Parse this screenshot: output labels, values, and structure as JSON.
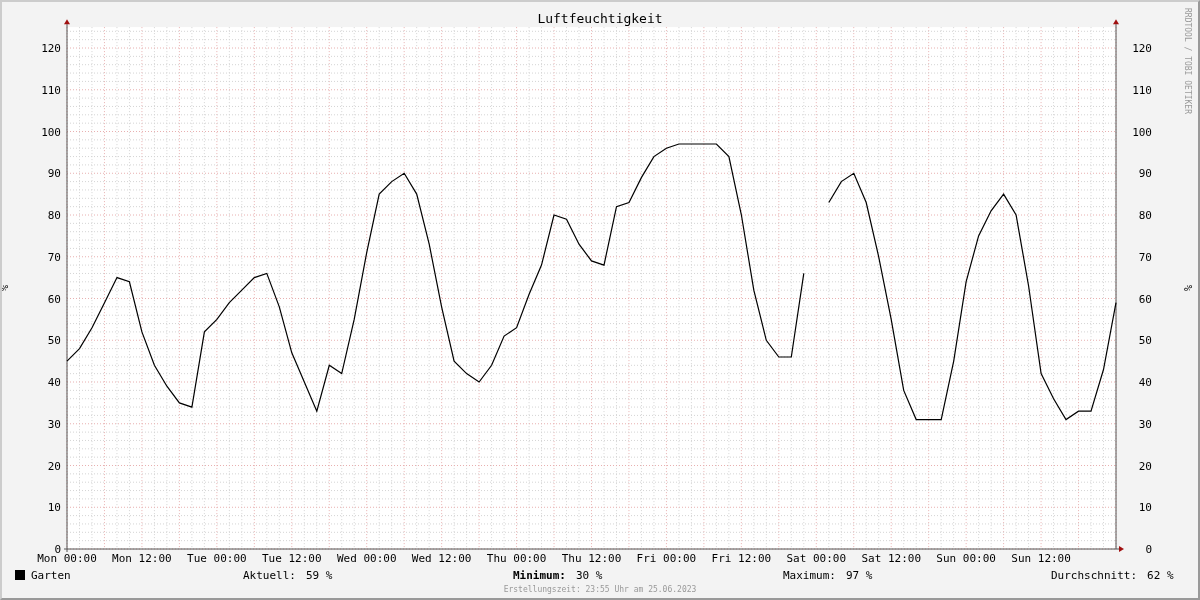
{
  "title": "Luftfeuchtigkeit",
  "credit": "RRDTOOL / TOBI OETIKER",
  "chart_data": {
    "type": "line",
    "ylabel": "%",
    "ylim": [
      0,
      125
    ],
    "categories": [
      "Mon 00:00",
      null,
      null,
      null,
      null,
      null,
      "Mon 12:00",
      null,
      null,
      null,
      null,
      null,
      "Tue 00:00",
      null,
      null,
      null,
      null,
      null,
      "Tue 12:00",
      null,
      null,
      null,
      null,
      null,
      "Wed 00:00",
      null,
      null,
      null,
      null,
      null,
      "Wed 12:00",
      null,
      null,
      null,
      null,
      null,
      "Thu 00:00",
      null,
      null,
      null,
      null,
      null,
      "Thu 12:00",
      null,
      null,
      null,
      null,
      null,
      "Fri 00:00",
      null,
      null,
      null,
      null,
      null,
      "Fri 12:00",
      null,
      null,
      null,
      null,
      null,
      "Sat 00:00",
      null,
      null,
      null,
      null,
      null,
      "Sat 12:00",
      null,
      null,
      null,
      null,
      null,
      "Sun 00:00",
      null,
      null,
      null,
      null,
      null,
      "Sun 12:00",
      null,
      null,
      null,
      null,
      null,
      null
    ],
    "yticks": [
      0,
      10,
      20,
      30,
      40,
      50,
      60,
      70,
      80,
      90,
      100,
      110,
      120
    ],
    "series": [
      {
        "name": "Garten",
        "color": "#000000",
        "values": [
          45,
          48,
          53,
          59,
          65,
          64,
          52,
          44,
          39,
          35,
          34,
          52,
          55,
          59,
          62,
          65,
          66,
          58,
          47,
          40,
          33,
          44,
          42,
          55,
          71,
          85,
          88,
          90,
          85,
          73,
          58,
          45,
          42,
          40,
          44,
          51,
          53,
          61,
          68,
          80,
          79,
          73,
          69,
          68,
          82,
          83,
          89,
          94,
          96,
          97,
          97,
          97,
          97,
          94,
          80,
          62,
          50,
          46,
          46,
          66,
          null,
          83,
          88,
          90,
          83,
          70,
          55,
          38,
          31,
          31,
          31,
          45,
          64,
          75,
          81,
          85,
          80,
          63,
          42,
          36,
          31,
          33,
          33,
          43,
          59
        ]
      }
    ]
  },
  "right_axis": {
    "label": "%",
    "ticks": [
      "120",
      "110",
      "100",
      "90",
      "80",
      "70",
      "60",
      "50",
      "40",
      "30",
      "20",
      "10",
      "0"
    ]
  },
  "legend_stats": [
    {
      "label": "Aktuell:",
      "value": "59 %",
      "bold": false
    },
    {
      "label": "Minimum:",
      "value": "30 %",
      "bold": true
    },
    {
      "label": "Maximum:",
      "value": "97 %",
      "bold": false
    },
    {
      "label": "Durchschnitt:",
      "value": "62 %",
      "bold": false
    }
  ],
  "footer": "Erstellungszeit: 23:55 Uhr am 25.06.2023"
}
